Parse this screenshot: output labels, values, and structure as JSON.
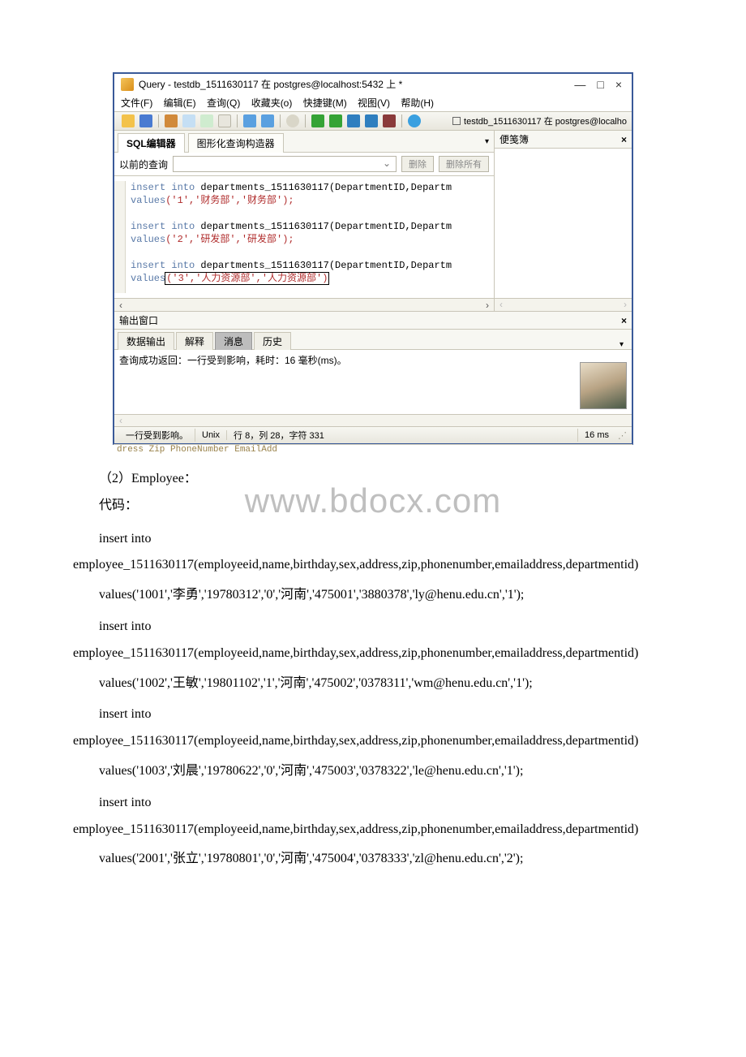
{
  "window": {
    "title": "Query - testdb_1511630117 在 postgres@localhost:5432 上 *",
    "minimize": "—",
    "maximize": "□",
    "close": "×"
  },
  "menus": {
    "file": "文件(F)",
    "edit": "编辑(E)",
    "query": "查询(Q)",
    "favorites": "收藏夹(o)",
    "macros": "快捷键(M)",
    "view": "视图(V)",
    "help": "帮助(H)"
  },
  "toolbar": {
    "dbpath": "testdb_1511630117 在 postgres@localho"
  },
  "tabs": {
    "sql": "SQL编辑器",
    "graphical": "图形化查询构造器"
  },
  "prevquery": {
    "label": "以前的查询",
    "delete": "删除",
    "deleteall": "删除所有"
  },
  "editor": {
    "l1a": "insert into",
    "l1b": " departments_1511630117(DepartmentID,Departm",
    "l2a": "values",
    "l2b": "('1','财务部','财务部');",
    "l3a": "insert into",
    "l3b": " departments_1511630117(DepartmentID,Departm",
    "l4a": "values",
    "l4b": "('2','研发部','研发部');",
    "l5a": "insert into",
    "l5b": " departments_1511630117(DepartmentID,Departm",
    "l6a": "values",
    "l6b": "('3','人力资源部','人力资源部')"
  },
  "scratchpad": {
    "title": "便笺簿",
    "close": "×"
  },
  "output": {
    "title": "输出窗口",
    "close": "×",
    "tab_data": "数据输出",
    "tab_explain": "解释",
    "tab_messages": "消息",
    "tab_history": "历史",
    "message": "查询成功返回：一行受到影响，耗时：16 毫秒(ms)。"
  },
  "status": {
    "affected": "一行受到影响。",
    "mode": "Unix",
    "pos": "行 8，列 28，字符 331",
    "time": "16 ms"
  },
  "leak": {
    "l1": "dress   Zip             PhoneNumber    EmailAdd"
  },
  "doc": {
    "employee_title": "（2）Employee：",
    "code_label": "代码：",
    "watermark": "www.bdocx.com",
    "ins_head": "insert into employee_1511630117(employeeid,name,birthday,sex,address,zip,phonenumber,emailaddress,departmentid)",
    "v1": "values('1001','李勇','19780312','0','河南','475001','3880378','ly@henu.edu.cn','1');",
    "v2": "values('1002','王敏','19801102','1','河南','475002','0378311','wm@henu.edu.cn','1');",
    "v3": "values('1003','刘晨','19780622','0','河南','475003','0378322','le@henu.edu.cn','1');",
    "v4": "values('2001','张立','19780801','0','河南','475004','0378333','zl@henu.edu.cn','2');"
  }
}
